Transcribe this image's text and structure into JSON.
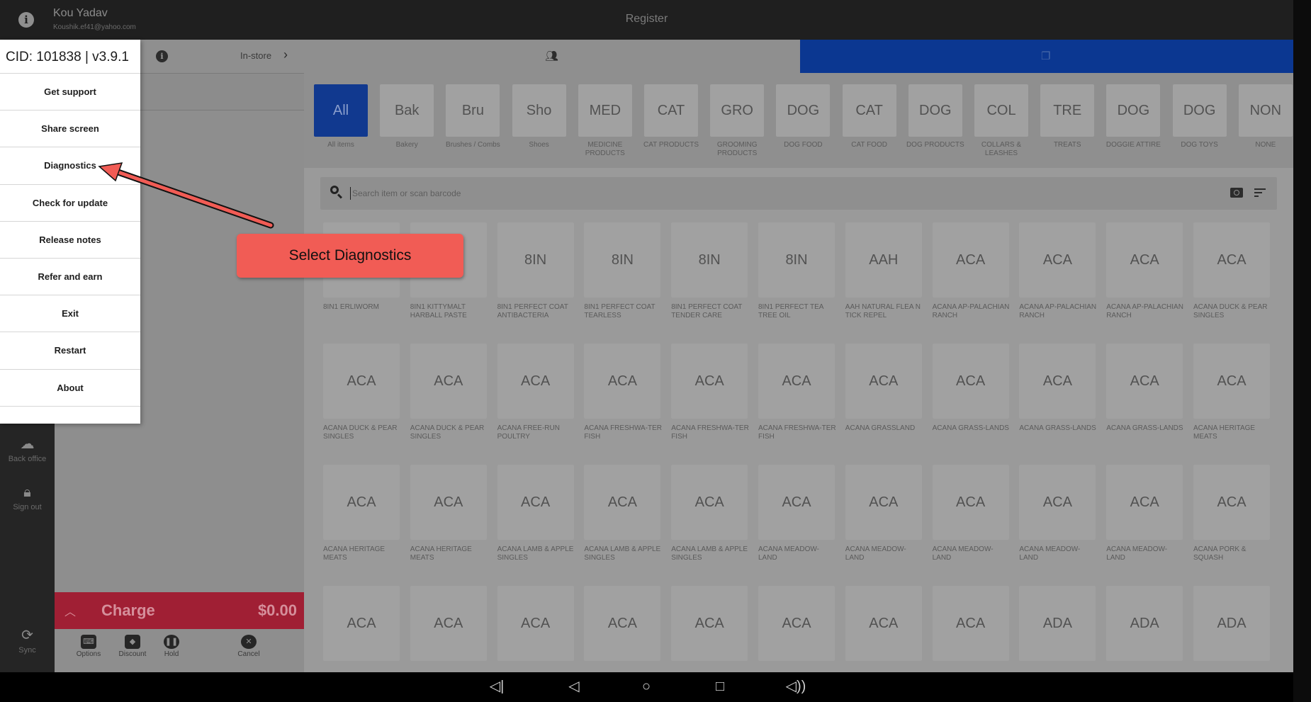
{
  "user": {
    "name": "Kou Yadav",
    "email": "Koushik.ef41@yahoo.com"
  },
  "header": {
    "title": "Register"
  },
  "ticket": {
    "mode": "In-store"
  },
  "charge": {
    "label": "Charge",
    "amount": "$0.00"
  },
  "actions": [
    "Options",
    "Discount",
    "Hold",
    "Cancel"
  ],
  "rail": {
    "back_office": "Back office",
    "sign_out": "Sign out",
    "sync": "Sync"
  },
  "categories": [
    {
      "code": "All",
      "name": "All items",
      "active": true
    },
    {
      "code": "Bak",
      "name": "Bakery"
    },
    {
      "code": "Bru",
      "name": "Brushes / Combs"
    },
    {
      "code": "Sho",
      "name": "Shoes"
    },
    {
      "code": "MED",
      "name": "MEDICINE PRODUCTS"
    },
    {
      "code": "CAT",
      "name": "CAT PRODUCTS"
    },
    {
      "code": "GRO",
      "name": "GROOMING PRODUCTS"
    },
    {
      "code": "DOG",
      "name": "DOG FOOD"
    },
    {
      "code": "CAT",
      "name": "CAT FOOD"
    },
    {
      "code": "DOG",
      "name": "DOG PRODUCTS"
    },
    {
      "code": "COL",
      "name": "COLLARS & LEASHES"
    },
    {
      "code": "TRE",
      "name": "TREATS"
    },
    {
      "code": "DOG",
      "name": "DOGGIE ATTIRE"
    },
    {
      "code": "DOG",
      "name": "DOG TOYS"
    },
    {
      "code": "NON",
      "name": "NONE"
    }
  ],
  "search": {
    "placeholder": "Search item or scan barcode"
  },
  "items": [
    {
      "code": "",
      "name": "8IN1 ERLIWORM"
    },
    {
      "code": "",
      "name": "8IN1 KITTYMALT HARBALL PASTE"
    },
    {
      "code": "8IN",
      "name": "8IN1 PERFECT COAT ANTIBACTERIA"
    },
    {
      "code": "8IN",
      "name": "8IN1 PERFECT COAT TEARLESS"
    },
    {
      "code": "8IN",
      "name": "8IN1 PERFECT COAT TENDER CARE"
    },
    {
      "code": "8IN",
      "name": "8IN1 PERFECT TEA TREE OIL"
    },
    {
      "code": "AAH",
      "name": "AAH NATURAL FLEA N TICK REPEL"
    },
    {
      "code": "ACA",
      "name": "ACANA AP-PALACHIAN RANCH"
    },
    {
      "code": "ACA",
      "name": "ACANA AP-PALACHIAN RANCH"
    },
    {
      "code": "ACA",
      "name": "ACANA AP-PALACHIAN RANCH"
    },
    {
      "code": "ACA",
      "name": "ACANA DUCK & PEAR SINGLES"
    },
    {
      "code": "ACA",
      "name": "ACANA DUCK & PEAR SINGLES"
    },
    {
      "code": "ACA",
      "name": "ACANA DUCK & PEAR SINGLES"
    },
    {
      "code": "ACA",
      "name": "ACANA FREE-RUN POULTRY"
    },
    {
      "code": "ACA",
      "name": "ACANA FRESHWA-TER FISH"
    },
    {
      "code": "ACA",
      "name": "ACANA FRESHWA-TER FISH"
    },
    {
      "code": "ACA",
      "name": "ACANA FRESHWA-TER FISH"
    },
    {
      "code": "ACA",
      "name": "ACANA GRASSLAND"
    },
    {
      "code": "ACA",
      "name": "ACANA GRASS-LANDS"
    },
    {
      "code": "ACA",
      "name": "ACANA GRASS-LANDS"
    },
    {
      "code": "ACA",
      "name": "ACANA GRASS-LANDS"
    },
    {
      "code": "ACA",
      "name": "ACANA HERITAGE MEATS"
    },
    {
      "code": "ACA",
      "name": "ACANA HERITAGE MEATS"
    },
    {
      "code": "ACA",
      "name": "ACANA HERITAGE MEATS"
    },
    {
      "code": "ACA",
      "name": "ACANA LAMB & APPLE SINGLES"
    },
    {
      "code": "ACA",
      "name": "ACANA LAMB & APPLE SINGLES"
    },
    {
      "code": "ACA",
      "name": "ACANA LAMB & APPLE SINGLES"
    },
    {
      "code": "ACA",
      "name": "ACANA MEADOW-LAND"
    },
    {
      "code": "ACA",
      "name": "ACANA MEADOW-LAND"
    },
    {
      "code": "ACA",
      "name": "ACANA MEADOW-LAND"
    },
    {
      "code": "ACA",
      "name": "ACANA MEADOW-LAND"
    },
    {
      "code": "ACA",
      "name": "ACANA MEADOW-LAND"
    },
    {
      "code": "ACA",
      "name": "ACANA PORK & SQUASH"
    },
    {
      "code": "ACA",
      "name": ""
    },
    {
      "code": "ACA",
      "name": ""
    },
    {
      "code": "ACA",
      "name": ""
    },
    {
      "code": "ACA",
      "name": ""
    },
    {
      "code": "ACA",
      "name": ""
    },
    {
      "code": "ACA",
      "name": ""
    },
    {
      "code": "ACA",
      "name": ""
    },
    {
      "code": "ACA",
      "name": ""
    },
    {
      "code": "ADA",
      "name": ""
    },
    {
      "code": "ADA",
      "name": ""
    },
    {
      "code": "ADA",
      "name": ""
    }
  ],
  "menu": {
    "header": "CID: 101838 | v3.9.1",
    "items": [
      "Get support",
      "Share screen",
      "Diagnostics",
      "Check for update",
      "Release notes",
      "Refer and earn",
      "Exit",
      "Restart",
      "About"
    ]
  },
  "annotation": {
    "text": "Select Diagnostics",
    "color": "#f15c55"
  },
  "colors": {
    "accent": "#0b3791",
    "charge": "#a01f34"
  }
}
